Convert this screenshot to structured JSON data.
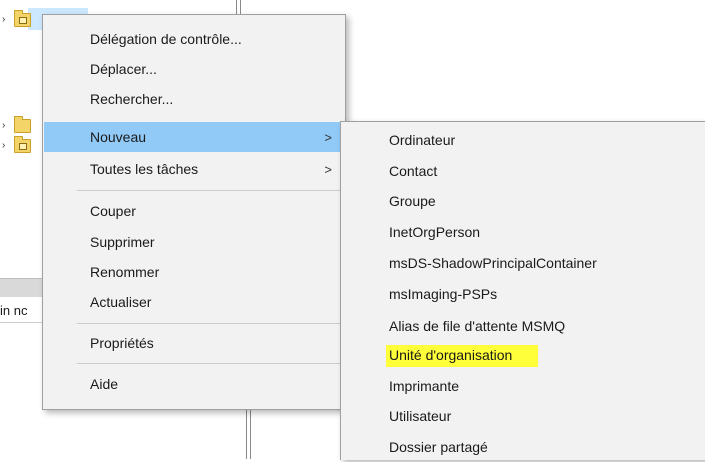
{
  "main_menu": {
    "items": [
      {
        "label": "Délégation de contrôle..."
      },
      {
        "label": "Déplacer..."
      },
      {
        "label": "Rechercher..."
      },
      {
        "label": "Nouveau",
        "arrow": ">"
      },
      {
        "label": "Toutes les tâches",
        "arrow": ">"
      },
      {
        "label": "Couper"
      },
      {
        "label": "Supprimer"
      },
      {
        "label": "Renommer"
      },
      {
        "label": "Actualiser"
      },
      {
        "label": "Propriétés"
      },
      {
        "label": "Aide"
      }
    ],
    "highlighted": "Nouveau"
  },
  "sub_menu": {
    "items": [
      {
        "label": "Ordinateur"
      },
      {
        "label": "Contact"
      },
      {
        "label": "Groupe"
      },
      {
        "label": "InetOrgPerson"
      },
      {
        "label": "msDS-ShadowPrincipalContainer"
      },
      {
        "label": "msImaging-PSPs"
      },
      {
        "label": "Alias de file d'attente MSMQ"
      },
      {
        "label": "Unité d'organisation"
      },
      {
        "label": "Imprimante"
      },
      {
        "label": "Utilisateur"
      },
      {
        "label": "Dossier partagé"
      }
    ],
    "marked_item": "Unité d'organisation",
    "marker_color": "#ffff3a"
  },
  "background": {
    "column_header_text": "in nc"
  },
  "colors": {
    "menu_bg": "#f2f2f2",
    "highlight": "#91c9f7",
    "selection": "#cce8ff"
  }
}
